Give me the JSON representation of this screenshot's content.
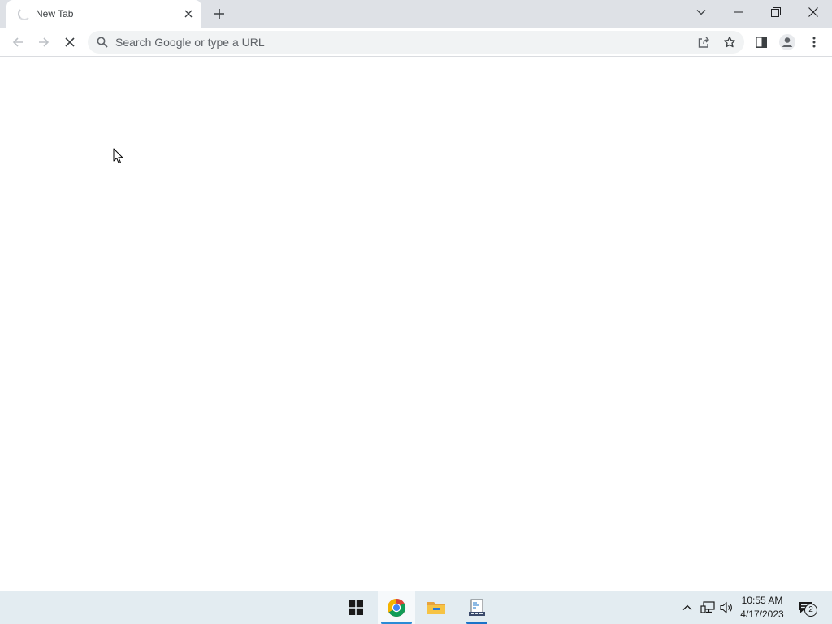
{
  "window": {
    "tab": {
      "title": "New Tab",
      "loading_icon": "spinner-icon",
      "close_icon": "close-icon"
    },
    "new_tab_icon": "plus-icon",
    "controls": {
      "tab_search_icon": "chevron-down-icon",
      "minimize_icon": "minimize-icon",
      "restore_icon": "restore-icon",
      "close_icon": "close-icon"
    }
  },
  "toolbar": {
    "back_icon": "arrow-left-icon",
    "forward_icon": "arrow-right-icon",
    "stop_icon": "close-icon",
    "omnibox": {
      "placeholder": "Search Google or type a URL",
      "value": "",
      "search_icon": "search-icon",
      "share_icon": "share-icon",
      "bookmark_icon": "star-icon"
    },
    "side_panel_icon": "side-panel-icon",
    "profile_icon": "profile-icon",
    "menu_icon": "more-vertical-icon"
  },
  "taskbar": {
    "apps": [
      {
        "name": "Start",
        "icon": "windows-start-icon"
      },
      {
        "name": "Google Chrome",
        "icon": "chrome-icon",
        "active": true
      },
      {
        "name": "File Explorer",
        "icon": "folder-icon"
      },
      {
        "name": "Notepad",
        "icon": "notepad-icon"
      }
    ],
    "tray": {
      "overflow_icon": "chevron-up-icon",
      "network_icon": "network-icon",
      "volume_icon": "volume-icon",
      "time": "10:55 AM",
      "date": "4/17/2023",
      "notification_icon": "notification-icon",
      "notification_count": "2"
    }
  },
  "colors": {
    "tabstrip_bg": "#dee1e6",
    "omnibox_bg": "#f1f3f4",
    "taskbar_bg": "#e3ecf1",
    "taskbar_accent": "#2a8bd6"
  }
}
